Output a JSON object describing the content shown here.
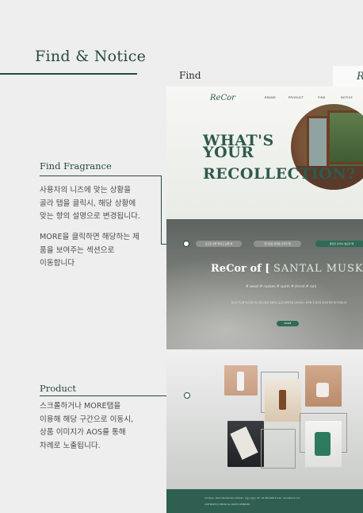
{
  "page": {
    "title": "Find & Notice"
  },
  "sections": {
    "find_fragrance": {
      "title": "Find Fragrance",
      "lines1": [
        "사용자의 니즈에 맞는 상황을",
        "골라 탭을 클릭시, 해당 상황에",
        "맞는 향의 설명으로 변경됩니다."
      ],
      "lines2": [
        "MORE을 클릭하면 해당하는 제",
        "품을 보여주는 섹션으로",
        "이동합니다"
      ]
    },
    "product": {
      "title": "Product",
      "lines": [
        "스크롤하거나 MORE탭을",
        "이용해  해당 구간으로  이동시,",
        "상품 이미지가 AOS를 통해",
        "차례로 노출됩니다."
      ]
    }
  },
  "mockup": {
    "tab_label": "Find",
    "tab_right_glyph": "R",
    "logo": "ReCor",
    "nav": [
      "BRAND",
      "PRODUCT",
      "FIND",
      "NOTICE"
    ],
    "hero_lines": [
      "WHAT'S",
      "YOUR",
      "RECOLLECTION?"
    ],
    "find_pills": [
      "포근한 잠을 청하고 싶을 때",
      "향기로운 하루를 시작할 때",
      "편안한 휴식이 필요할 때"
    ],
    "find_title_prefix": "ReCor of [",
    "find_title_scent": "SANTAL MUSK",
    "find_title_suffix": "]",
    "find_tags": "# wood  # custom  # warm  # forest  # rain",
    "find_desc": "따스한 우드와 부드러운 머스크의 조화로 차분하고 포근한 분위기를 선사합니다. 하루의 끝 편안한 휴식을 원할 때 추천합니다.",
    "more_label": "MORE",
    "footer_line1": "Company : ReCor Recollection  Address : 서울시 강남구  Tel : 02-000-0000  E-mail : recor@recor.com",
    "footer_line2": "COPYRIGHT(C) RECOR ALL RIGHTS RESERVED."
  },
  "colors": {
    "brand_green": "#274a41",
    "hero_text": "#2e5a4e",
    "footer": "#2f5f50"
  }
}
